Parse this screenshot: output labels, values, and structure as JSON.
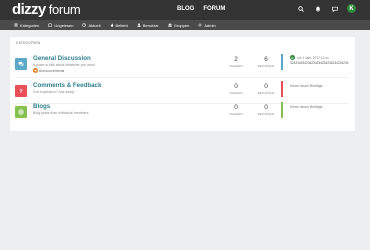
{
  "brand": {
    "name_bold": "dizzy",
    "name_light": "forum"
  },
  "nav": {
    "links": [
      "BLOG",
      "FORUM"
    ]
  },
  "user": {
    "avatar_letter": "K"
  },
  "subnav": {
    "items": [
      {
        "label": "Kategorien",
        "icon": "list-icon"
      },
      {
        "label": "Ungelesen",
        "icon": "inbox-icon"
      },
      {
        "label": "Aktuell",
        "icon": "clock-icon"
      },
      {
        "label": "Beliebt",
        "icon": "fire-icon"
      },
      {
        "label": "Benutzer",
        "icon": "user-icon"
      },
      {
        "label": "Gruppen",
        "icon": "group-icon"
      },
      {
        "label": "Admin",
        "icon": "cogs-icon"
      }
    ]
  },
  "categories_header": "KATEGORIEN",
  "stat_labels": {
    "topics": "THEMEN",
    "posts": "BEITRÄGE"
  },
  "categories": [
    {
      "title": "General Discussion",
      "description": "A place to talk about whatever you want",
      "color": "#5aa9c9",
      "icon": "comments-icon",
      "subcategory": "Announcements",
      "topics": "2",
      "posts": "6",
      "last_post": {
        "avatar_letter": "K",
        "date": "vor 1 Jahr, 2017-12-xx",
        "text": "324234234234234234234234234234234"
      }
    },
    {
      "title": "Comments & Feedback",
      "description": "Got a question? Ask away!",
      "color": "#e84f56",
      "icon": "question-icon",
      "subcategory": "",
      "topics": "0",
      "posts": "0",
      "no_posts_text": "Keine neuen Beiträge"
    },
    {
      "title": "Blogs",
      "description": "Blog posts from individual members",
      "color": "#86c04e",
      "icon": "globe-icon",
      "subcategory": "",
      "topics": "0",
      "posts": "0",
      "no_posts_text": "Keine neuen Beiträge"
    }
  ]
}
